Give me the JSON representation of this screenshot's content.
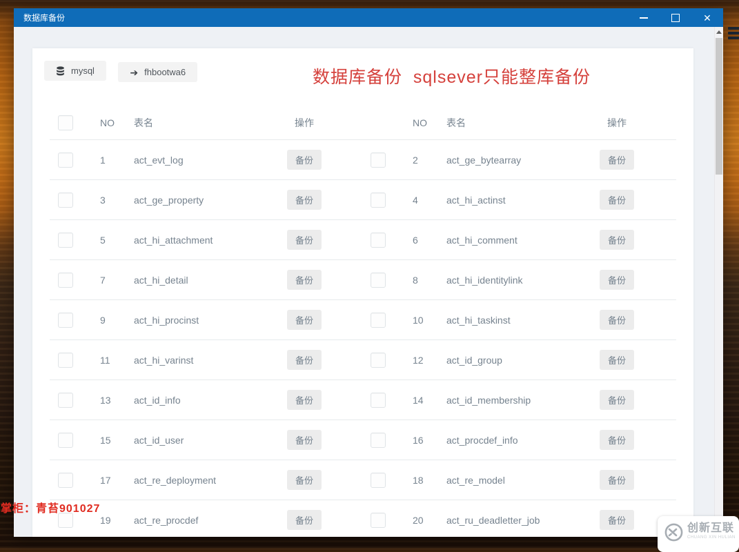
{
  "window": {
    "title": "数据库备份",
    "controls": {
      "minimize_icon": "─",
      "maximize_icon": "□",
      "close_icon": "✕"
    }
  },
  "toolbar": {
    "db_button_label": "mysql",
    "db_button_icon": "database-icon",
    "target_button_label": "fhbootwa6",
    "target_button_icon": "arrow-right-icon",
    "arrow_glyph": "➔",
    "heading": "数据库备份  sqlsever只能整库备份"
  },
  "table": {
    "headers": {
      "no": "NO",
      "name": "表名",
      "action": "操作"
    },
    "action_label": "备份",
    "rows": [
      {
        "left_no": "1",
        "left_name": "act_evt_log",
        "right_no": "2",
        "right_name": "act_ge_bytearray"
      },
      {
        "left_no": "3",
        "left_name": "act_ge_property",
        "right_no": "4",
        "right_name": "act_hi_actinst"
      },
      {
        "left_no": "5",
        "left_name": "act_hi_attachment",
        "right_no": "6",
        "right_name": "act_hi_comment"
      },
      {
        "left_no": "7",
        "left_name": "act_hi_detail",
        "right_no": "8",
        "right_name": "act_hi_identitylink"
      },
      {
        "left_no": "9",
        "left_name": "act_hi_procinst",
        "right_no": "10",
        "right_name": "act_hi_taskinst"
      },
      {
        "left_no": "11",
        "left_name": "act_hi_varinst",
        "right_no": "12",
        "right_name": "act_id_group"
      },
      {
        "left_no": "13",
        "left_name": "act_id_info",
        "right_no": "14",
        "right_name": "act_id_membership"
      },
      {
        "left_no": "15",
        "left_name": "act_id_user",
        "right_no": "16",
        "right_name": "act_procdef_info"
      },
      {
        "left_no": "17",
        "left_name": "act_re_deployment",
        "right_no": "18",
        "right_name": "act_re_model"
      },
      {
        "left_no": "19",
        "left_name": "act_re_procdef",
        "right_no": "20",
        "right_name": "act_ru_deadletter_job"
      }
    ]
  },
  "watermarks": {
    "seller": "掌柜：青苔901027",
    "brand": "创新互联",
    "brand_sub": "CHUANG XIN HULIAN"
  },
  "colors": {
    "titlebar_blue": "#0f6cb8",
    "heading_red": "#d5413c",
    "seller_red": "#e02b20",
    "content_bg": "#eef1f5"
  }
}
